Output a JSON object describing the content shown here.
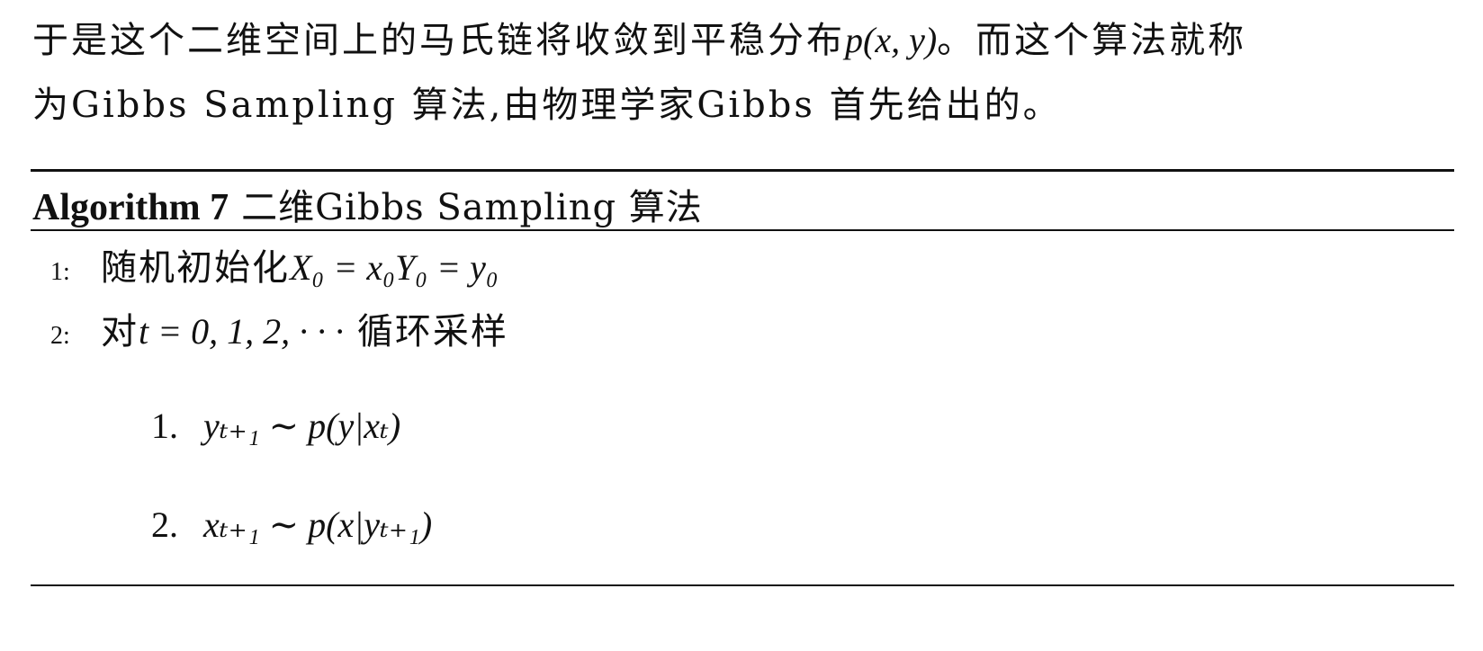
{
  "paragraph": {
    "line1_text": "于是这个二维空间上的马氏链将收敛到平稳分布",
    "line1_math": "p(x, y)",
    "line1_tail": "。而这个算法就称",
    "line2": "为Gibbs Sampling 算法,由物理学家Gibbs 首先给出的。"
  },
  "algorithm": {
    "label": "Algorithm 7",
    "title": "二维Gibbs Sampling 算法",
    "steps": [
      {
        "num": "1:",
        "text": "随机初始化",
        "math": "X₀ = x₀Y₀ = y₀"
      },
      {
        "num": "2:",
        "text_pre": "对",
        "math": "t = 0, 1, 2, · · ·",
        "text_post": " 循环采样"
      }
    ],
    "substeps": [
      {
        "num": "1.",
        "math": "yₜ₊₁ ∼ p(y|xₜ)"
      },
      {
        "num": "2.",
        "math": "xₜ₊₁ ∼ p(x|yₜ₊₁)"
      }
    ]
  }
}
